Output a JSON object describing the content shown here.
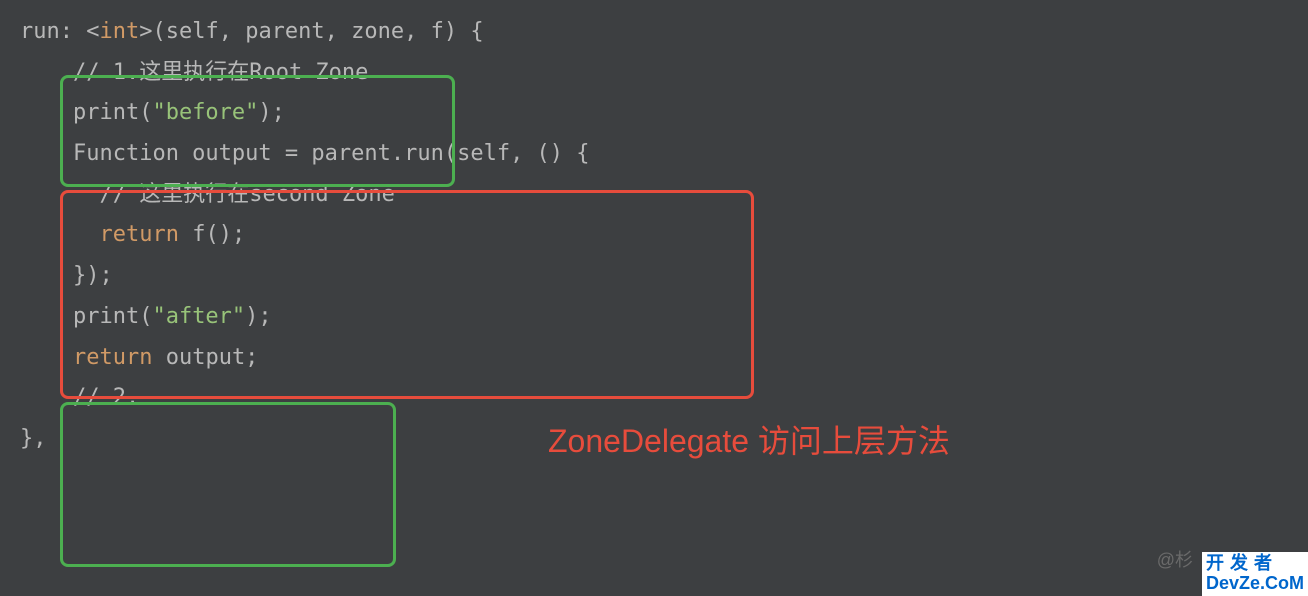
{
  "code": {
    "line1_part1": "run: <",
    "line1_keyword": "int",
    "line1_part2": ">(self, parent, zone, f) {",
    "line2_comment": "    // 1.这里执行在Root Zone",
    "line3_part1": "    print(",
    "line3_string": "\"before\"",
    "line3_part2": ");",
    "line4": "    Function output = parent.run(self, () {",
    "line5_comment": "      // 这里执行在second Zone",
    "line6_part1": "      ",
    "line6_keyword": "return",
    "line6_part2": " f();",
    "line7": "    });",
    "line8_part1": "    print(",
    "line8_string": "\"after\"",
    "line8_part2": ");",
    "line9_part1": "    ",
    "line9_keyword": "return",
    "line9_part2": " output;",
    "line10_comment": "    // 2.",
    "line11": "},"
  },
  "annotation": "ZoneDelegate 访问上层方法",
  "watermark": "@杉",
  "logo": {
    "line1": "开发者",
    "line2": "DevZe.CoM"
  }
}
